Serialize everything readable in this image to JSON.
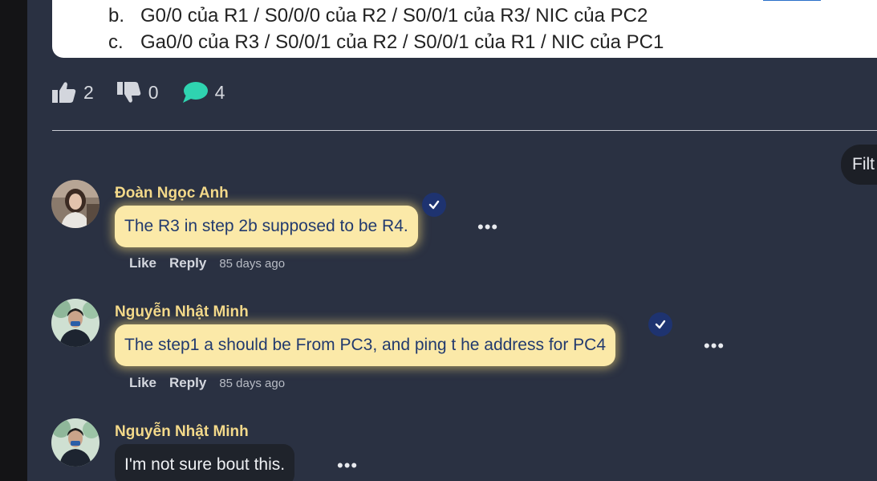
{
  "question": {
    "options": [
      {
        "letter": "b.",
        "text": "G0/0 của R1 / S0/0/0 của R2 / S0/0/1 của R3/ NIC của PC2"
      },
      {
        "letter": "c.",
        "text": "Ga0/0 của R3 / S0/0/1 của R2 / S0/0/1 của R1 / NIC của PC1"
      }
    ]
  },
  "reactions": {
    "likes": "2",
    "dislikes": "0",
    "comments": "4"
  },
  "filter_label": "Filt",
  "comments": [
    {
      "author": "Đoàn Ngọc Anh",
      "text": "The R3 in step 2b supposed to be R4.",
      "like": "Like",
      "reply": "Reply",
      "time": "85 days ago",
      "verified": true
    },
    {
      "author": "Nguyễn Nhật Minh",
      "text": "The step1 a should be From PC3, and ping t he address for PC4",
      "like": "Like",
      "reply": "Reply",
      "time": "85 days ago",
      "verified": true
    },
    {
      "author": "Nguyễn Nhật Minh",
      "text": "I'm not sure bout this.",
      "verified": false
    }
  ],
  "more_glyph": "•••",
  "colors": {
    "background": "#2a3142",
    "author": "#f3d98a",
    "highlight_bubble": "#fbe9a8",
    "highlight_text": "#223a6e",
    "comment_icon": "#2fd3b0"
  },
  "icons": [
    "thumbs-up-icon",
    "thumbs-down-icon",
    "comment-icon",
    "verified-check-icon",
    "more-options-icon"
  ]
}
